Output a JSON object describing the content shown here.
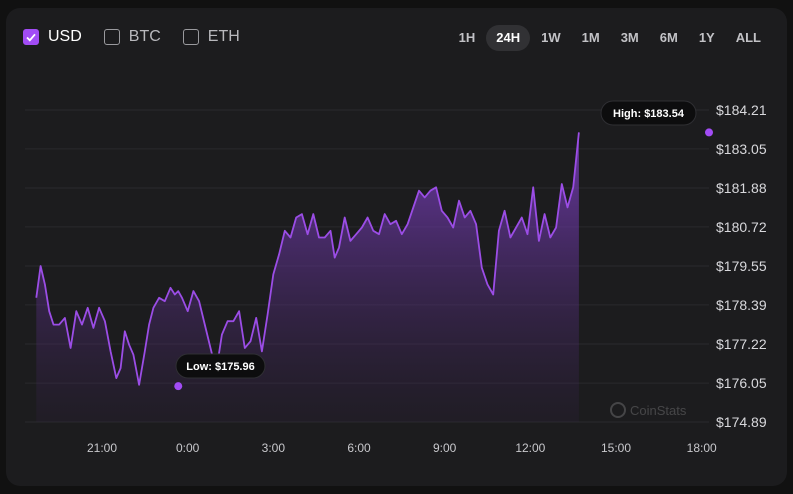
{
  "currencies": [
    {
      "label": "USD",
      "checked": true
    },
    {
      "label": "BTC",
      "checked": false
    },
    {
      "label": "ETH",
      "checked": false
    }
  ],
  "periods": [
    {
      "label": "1H",
      "active": false
    },
    {
      "label": "24H",
      "active": true
    },
    {
      "label": "1W",
      "active": false
    },
    {
      "label": "1M",
      "active": false
    },
    {
      "label": "3M",
      "active": false
    },
    {
      "label": "6M",
      "active": false
    },
    {
      "label": "1Y",
      "active": false
    },
    {
      "label": "ALL",
      "active": false
    }
  ],
  "watermark": "CoinStats",
  "colors": {
    "accent": "#a24cf5",
    "line": "#9b4de6",
    "background": "#1c1c1e"
  },
  "chart_data": {
    "type": "line",
    "currency": "USD",
    "x_tick_labels": [
      "21:00",
      "0:00",
      "3:00",
      "6:00",
      "9:00",
      "12:00",
      "15:00",
      "18:00"
    ],
    "y_tick_labels": [
      "$184.21",
      "$183.05",
      "$181.88",
      "$180.72",
      "$179.55",
      "$178.39",
      "$177.22",
      "$176.05",
      "$174.89"
    ],
    "y_ticks": [
      184.21,
      183.05,
      181.88,
      180.72,
      179.55,
      178.39,
      177.22,
      176.05,
      174.89
    ],
    "ylim": [
      174.89,
      184.21
    ],
    "grid": true,
    "high": {
      "label": "High: $183.54",
      "value": 183.54,
      "time": "18:16"
    },
    "low": {
      "label": "Low: $175.96",
      "value": 175.96,
      "time": "23:40"
    },
    "x_hours": [
      18.7,
      18.85,
      19,
      19.15,
      19.3,
      19.5,
      19.7,
      19.9,
      20.1,
      20.3,
      20.5,
      20.7,
      20.9,
      21.1,
      21.3,
      21.5,
      21.65,
      21.8,
      21.95,
      22.1,
      22.3,
      22.5,
      22.65,
      22.8,
      23,
      23.2,
      23.4,
      23.55,
      23.67,
      23.8,
      24,
      24.2,
      24.4,
      24.6,
      24.8,
      25,
      25.2,
      25.4,
      25.6,
      25.8,
      26,
      26.2,
      26.4,
      26.6,
      26.8,
      27,
      27.2,
      27.4,
      27.6,
      27.8,
      28,
      28.2,
      28.4,
      28.6,
      28.8,
      29,
      29.15,
      29.3,
      29.5,
      29.7,
      29.9,
      30.1,
      30.3,
      30.5,
      30.7,
      30.9,
      31.1,
      31.3,
      31.5,
      31.7,
      31.9,
      32.1,
      32.3,
      32.5,
      32.7,
      32.9,
      33.1,
      33.3,
      33.5,
      33.7,
      33.9,
      34.1,
      34.3,
      34.5,
      34.7,
      34.9,
      35.1,
      35.3,
      35.5,
      35.7,
      35.9,
      36.1,
      36.3,
      36.5,
      36.7,
      36.9,
      37.1,
      37.3,
      37.5,
      37.7,
      37.9,
      38.1,
      38.3,
      38.5,
      38.7,
      38.9,
      39.1,
      39.3,
      39.5,
      39.7,
      39.9,
      40.1,
      40.3,
      40.5,
      40.7,
      40.9,
      41.1,
      41.3,
      41.45,
      41.6,
      41.8,
      41.95,
      42.1,
      42.2,
      42.27
    ],
    "y_values": [
      178.6,
      179.55,
      179.0,
      178.2,
      177.8,
      177.8,
      178.0,
      177.1,
      178.2,
      177.8,
      178.3,
      177.7,
      178.3,
      177.9,
      177.0,
      176.2,
      176.5,
      177.6,
      177.2,
      176.9,
      176.0,
      177.0,
      177.8,
      178.3,
      178.6,
      178.5,
      178.9,
      178.7,
      178.8,
      178.6,
      178.2,
      178.8,
      178.5,
      177.8,
      177.1,
      176.4,
      177.5,
      177.9,
      177.9,
      178.2,
      177.1,
      177.3,
      178.0,
      177.0,
      178.1,
      179.3,
      179.9,
      180.6,
      180.4,
      181.0,
      181.1,
      180.5,
      181.1,
      180.4,
      180.4,
      180.6,
      179.8,
      180.1,
      181.0,
      180.3,
      180.5,
      180.7,
      181.0,
      180.6,
      180.5,
      181.1,
      180.8,
      180.9,
      180.5,
      180.8,
      181.3,
      181.8,
      181.6,
      181.8,
      181.9,
      181.2,
      181.0,
      180.7,
      181.5,
      181.0,
      181.2,
      180.8,
      179.5,
      179.0,
      178.7,
      180.6,
      181.2,
      180.4,
      180.7,
      181.0,
      180.5,
      181.9,
      180.3,
      181.1,
      180.4,
      180.7,
      182.0,
      181.3,
      181.9,
      183.54
    ],
    "series_note": "Values prior to 23:55 shown in order from left; series runs from about 18:40 to 18:16 next day"
  }
}
